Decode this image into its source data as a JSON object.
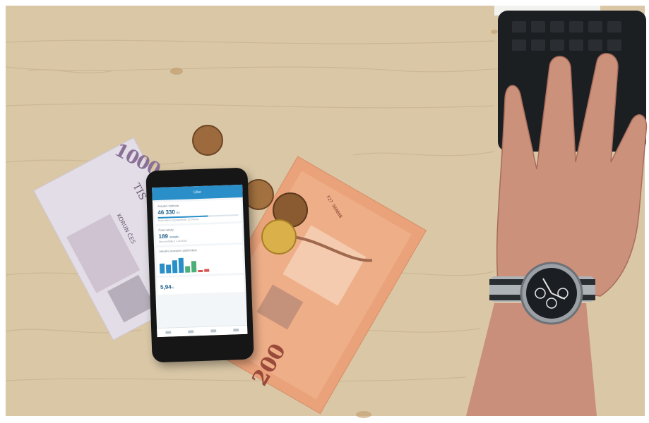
{
  "photo": {
    "subject": "smartphone with investment app on Czech banknotes and coins beside a hand with wristwatch on keyboard",
    "colors": {
      "table": "#d9c7a6",
      "table_dark": "#c8b28e",
      "banknote_200": "#e9a27a",
      "banknote_1000": "#e2dde6",
      "coin": "#9c6a3c",
      "coin_gold": "#d9b04a",
      "skin": "#c98f7a",
      "keyboard": "#1c1f22",
      "app_accent": "#2a8fc9"
    }
  },
  "banknotes": {
    "note_1000_number": "1000",
    "note_1000_text": "TIS",
    "note_1000_sub": "KORUN ČES",
    "note_200_number": "200",
    "note_200_serial": "F27 560098"
  },
  "phone_app": {
    "header": "Účet",
    "card1": {
      "label": "Aktuální hodnota",
      "value": "46 330",
      "unit": "Kč",
      "note": "Nový výnos za posledních 12 měsíců",
      "progress": 0.62
    },
    "card2": {
      "label": "Čisté vklady",
      "value": "189",
      "unit": "investic",
      "note": "Stav portfolia k 1.10.2018"
    },
    "card3": {
      "label": "Aktuální investiční podíl/měsíc",
      "bars": [
        {
          "value": 0.55,
          "color": "#2a8fc9"
        },
        {
          "value": 0.45,
          "color": "#2a8fc9"
        },
        {
          "value": 0.7,
          "color": "#2a8fc9"
        },
        {
          "value": 0.8,
          "color": "#2a8fc9"
        },
        {
          "value": 0.35,
          "color": "#4caf7a"
        },
        {
          "value": 0.6,
          "color": "#4caf7a"
        },
        {
          "value": 0.1,
          "color": "#d9534f"
        },
        {
          "value": 0.15,
          "color": "#d9534f"
        }
      ]
    },
    "card4": {
      "value": "5,94",
      "unit": "%"
    }
  },
  "watch": {
    "dial_color": "#1b1e22",
    "marker_color": "#e8e8e8"
  }
}
